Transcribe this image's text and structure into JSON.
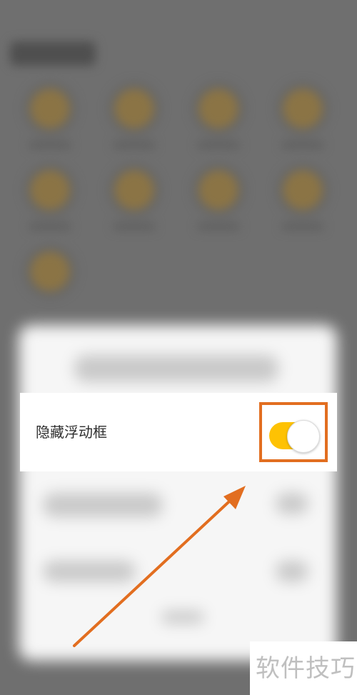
{
  "settings": {
    "hide_floating_box_label": "隐藏浮动框",
    "hide_floating_box_enabled": true
  },
  "watermark": {
    "text": "软件技巧"
  },
  "colors": {
    "toggle_on": "#fec203",
    "highlight": "#e26e20",
    "overlay": "#6f6f6f"
  },
  "icons": {
    "annotation": "arrow-icon"
  }
}
